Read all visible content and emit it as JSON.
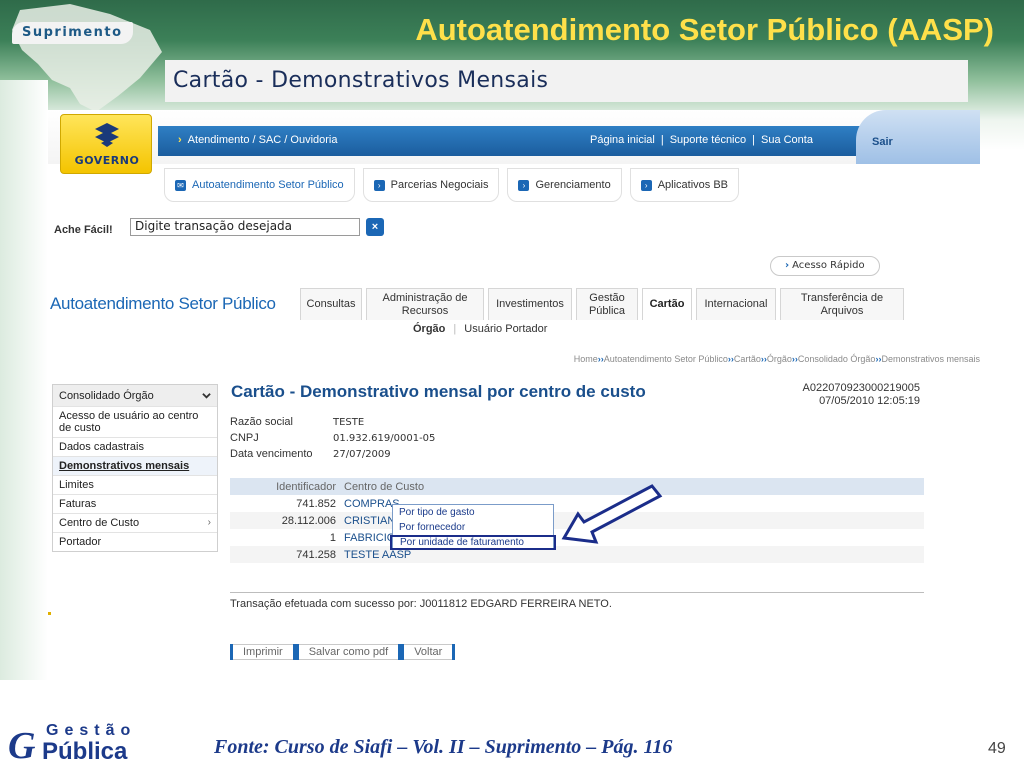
{
  "slide": {
    "badge": "Suprimento",
    "title": "Autoatendimento Setor Público (AASP)",
    "subtitle": "Cartão  - Demonstrativos Mensais",
    "footer_source": "Fonte: Curso de Siafi – Vol. II – Suprimento – Pág. 116",
    "page_number": "49",
    "footer_logo": {
      "line1": "Gestão",
      "line2": "Pública"
    }
  },
  "header": {
    "logo_text": "GOVERNO",
    "top_link": "Atendimento / SAC / Ouvidoria",
    "nav": [
      "Página inicial",
      "Suporte técnico",
      "Sua Conta"
    ],
    "logout": "Sair"
  },
  "system_tabs": [
    "Autoatendimento Setor Público",
    "Parcerias Negociais",
    "Gerenciamento",
    "Aplicativos BB"
  ],
  "search": {
    "label": "Ache Fácil!",
    "value": "Digite transação desejada",
    "go": "×"
  },
  "quick_access": "Acesso Rápido",
  "section": {
    "title": "Autoatendimento Setor Público",
    "tabs": [
      "Consultas",
      "Administração de Recursos",
      "Investimentos",
      "Gestão Pública",
      "Cartão",
      "Internacional",
      "Transferência de Arquivos"
    ],
    "active_tab": "Cartão",
    "subtabs": [
      "Órgão",
      "Usuário Portador"
    ]
  },
  "breadcrumb": [
    "Home",
    "Autoatendimento Setor Público",
    "Cartão",
    "Órgão",
    "Consolidado Órgão",
    "Demonstrativos mensais"
  ],
  "side_menu": {
    "header": "Consolidado Órgão",
    "items": [
      "Acesso de usuário ao centro de custo",
      "Dados cadastrais",
      "Demonstrativos mensais",
      "Limites",
      "Faturas",
      "Centro de Custo",
      "Portador"
    ]
  },
  "content": {
    "title": "Cartão - Demonstrativo mensal por centro de custo",
    "protocol": "A022070923000219005",
    "datetime": "07/05/2010 12:05:19",
    "info": [
      {
        "label": "Razão social",
        "value": "TESTE"
      },
      {
        "label": "CNPJ",
        "value": "01.932.619/0001-05"
      },
      {
        "label": "Data vencimento",
        "value": "27/07/2009"
      }
    ],
    "table": {
      "columns": [
        "Identificador",
        "Centro de Custo"
      ],
      "rows": [
        {
          "id": "741.852",
          "name": "COMPRAS"
        },
        {
          "id": "28.112.006",
          "name": "CRISTIANE"
        },
        {
          "id": "1",
          "name": "FABRICIO"
        },
        {
          "id": "741.258",
          "name": "TESTE AASP"
        }
      ]
    },
    "popup_options": [
      "Por tipo de gasto",
      "Por fornecedor",
      "Por unidade de faturamento"
    ],
    "status": "Transação efetuada com sucesso por: J0011812 EDGARD FERREIRA NETO.",
    "actions": [
      "Imprimir",
      "Salvar como pdf",
      "Voltar"
    ]
  },
  "colors": {
    "accent_blue": "#1b67b5",
    "title_yellow": "#ffe04a",
    "slide_green": "#3c8058"
  }
}
